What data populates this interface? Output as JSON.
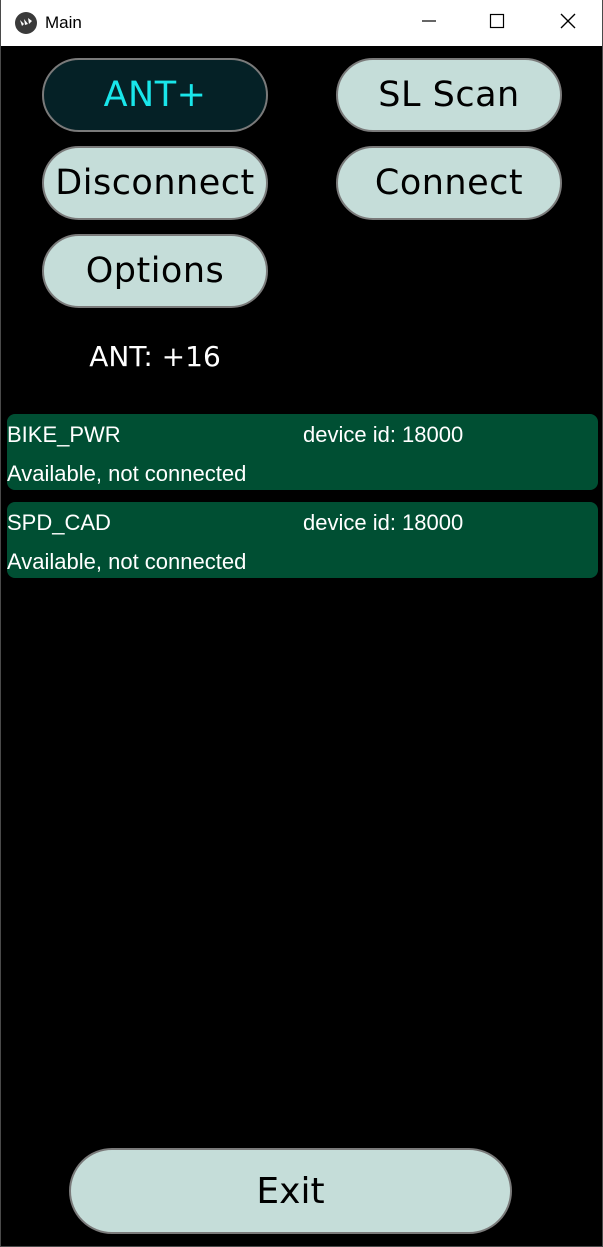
{
  "window": {
    "title": "Main"
  },
  "buttons": {
    "ant": "ANT+",
    "sl_scan": "SL Scan",
    "disconnect": "Disconnect",
    "connect": "Connect",
    "options": "Options",
    "exit": "Exit"
  },
  "status": {
    "text": "ANT: +16"
  },
  "devices": [
    {
      "name": "BIKE_PWR",
      "id": "device id: 18000",
      "status": "Available, not connected"
    },
    {
      "name": "SPD_CAD",
      "id": "device id: 18000",
      "status": "Available, not connected"
    }
  ],
  "colors": {
    "background": "#000000",
    "button_bg": "#c5ddd9",
    "button_active_bg": "#052126",
    "button_active_text": "#19e6ea",
    "card_bg": "#004f33"
  },
  "icons": {
    "app": "kivy-logo-icon",
    "minimize": "minimize-icon",
    "maximize": "maximize-icon",
    "close": "close-icon"
  }
}
